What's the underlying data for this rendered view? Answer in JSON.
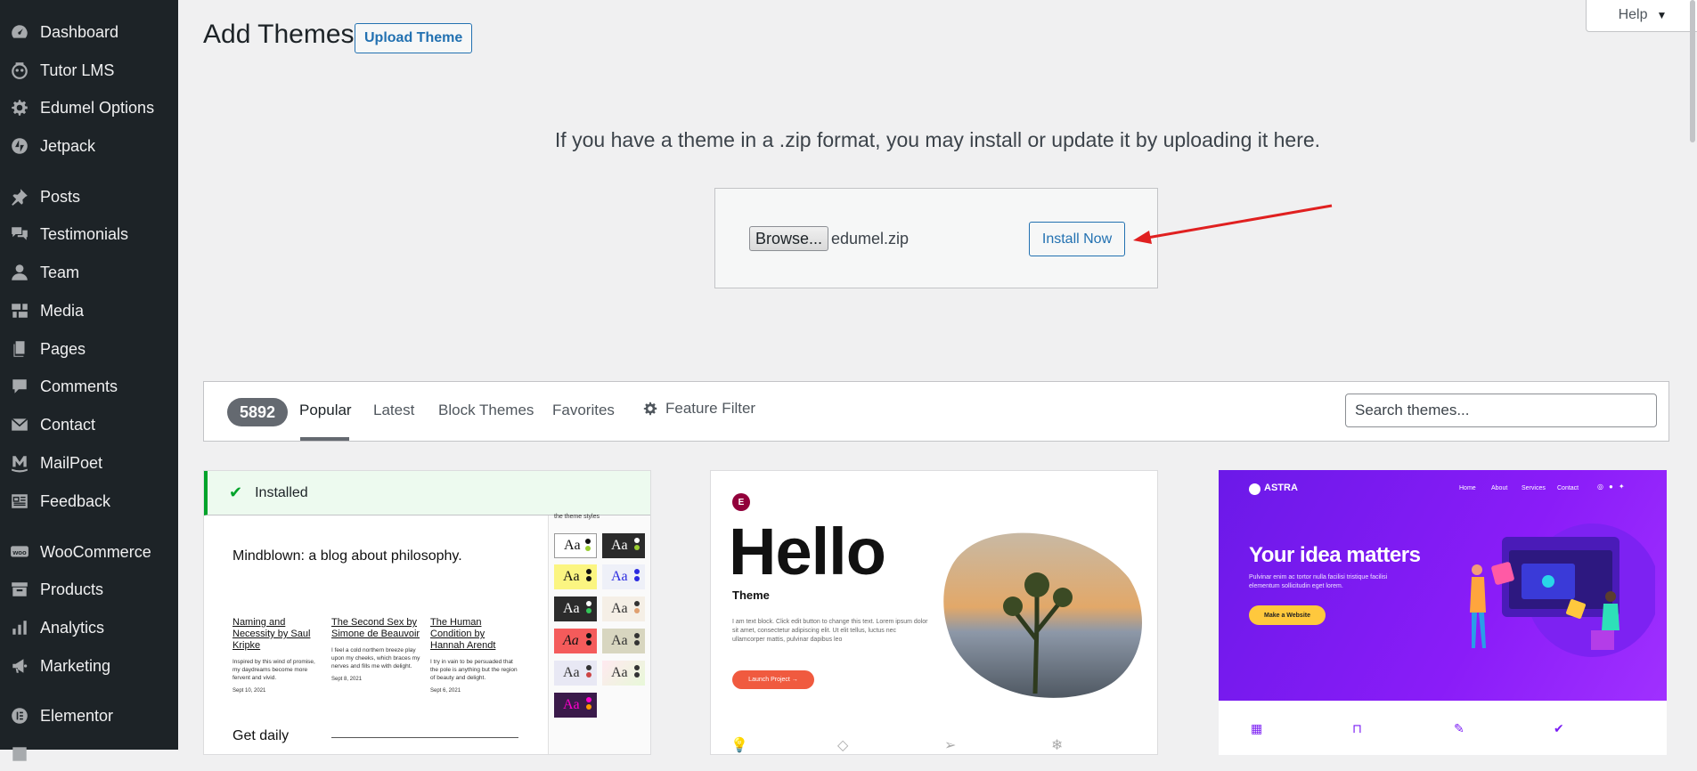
{
  "sidebar": {
    "items": [
      {
        "label": "Dashboard",
        "icon": "dashboard-icon"
      },
      {
        "label": "Tutor LMS",
        "icon": "tutor-icon"
      },
      {
        "label": "Edumel Options",
        "icon": "gear-icon"
      },
      {
        "label": "Jetpack",
        "icon": "jetpack-icon"
      },
      {
        "label": "Posts",
        "icon": "pin-icon"
      },
      {
        "label": "Testimonials",
        "icon": "comments-icon"
      },
      {
        "label": "Team",
        "icon": "user-icon"
      },
      {
        "label": "Media",
        "icon": "media-icon"
      },
      {
        "label": "Pages",
        "icon": "pages-icon"
      },
      {
        "label": "Comments",
        "icon": "comment-icon"
      },
      {
        "label": "Contact",
        "icon": "mail-icon"
      },
      {
        "label": "MailPoet",
        "icon": "mailpoet-icon"
      },
      {
        "label": "Feedback",
        "icon": "feedback-icon"
      },
      {
        "label": "WooCommerce",
        "icon": "woo-icon"
      },
      {
        "label": "Products",
        "icon": "archive-icon"
      },
      {
        "label": "Analytics",
        "icon": "chart-icon"
      },
      {
        "label": "Marketing",
        "icon": "megaphone-icon"
      },
      {
        "label": "Elementor",
        "icon": "elementor-icon"
      }
    ]
  },
  "header": {
    "title": "Add Themes",
    "upload_label": "Upload Theme",
    "help_label": "Help"
  },
  "upload": {
    "description": "If you have a theme in a .zip format, you may install or update it by uploading it here.",
    "browse_label": "Browse...",
    "file_name": "edumel.zip",
    "install_label": "Install Now"
  },
  "filter": {
    "count": "5892",
    "tabs": [
      "Popular",
      "Latest",
      "Block Themes",
      "Favorites"
    ],
    "active_tab": "Popular",
    "feature_filter_label": "Feature Filter",
    "search_placeholder": "Search themes..."
  },
  "themes": {
    "installed": {
      "status": "Installed",
      "heading": "Mindblown: a blog about philosophy.",
      "styles_caption": "the theme styles",
      "posts": [
        {
          "title": "Naming and Necessity by Saul Kripke",
          "excerpt": "Inspired by this wind of promise, my daydreams become more fervent and vivid.",
          "date": "Sept 10, 2021"
        },
        {
          "title": "The Second Sex by Simone de Beauvoir",
          "excerpt": "I feel a cold northern breeze play upon my cheeks, which braces my nerves and fills me with delight.",
          "date": "Sept 8, 2021"
        },
        {
          "title": "The Human Condition by Hannah Arendt",
          "excerpt": "I try in vain to be persuaded that the pole is anything but the region of beauty and delight.",
          "date": "Sept 6, 2021"
        }
      ],
      "footer_heading": "Get daily",
      "style_swatch_label": "Aa"
    },
    "hello": {
      "title": "Hello",
      "subtitle": "Theme",
      "body": "I am text block. Click edit button to change this text. Lorem ipsum dolor sit amet, consectetur adipiscing elit. Ut elit tellus, luctus nec ullamcorper mattis, pulvinar dapibus leo",
      "button": "Launch Project →"
    },
    "astra": {
      "brand": "ASTRA",
      "nav": [
        "Home",
        "About",
        "Services",
        "Contact"
      ],
      "headline": "Your idea matters",
      "body": "Pulvinar enim ac tortor nulla facilisi tristique facilisi elementum sollicitudin eget lorem.",
      "button": "Make a Website"
    }
  },
  "colors": {
    "sidebar_bg": "#1d2327",
    "accent": "#2271b1",
    "installed_green": "#00a32a",
    "arrow": "#e02020",
    "astra_purple": "#7a1cf4"
  }
}
